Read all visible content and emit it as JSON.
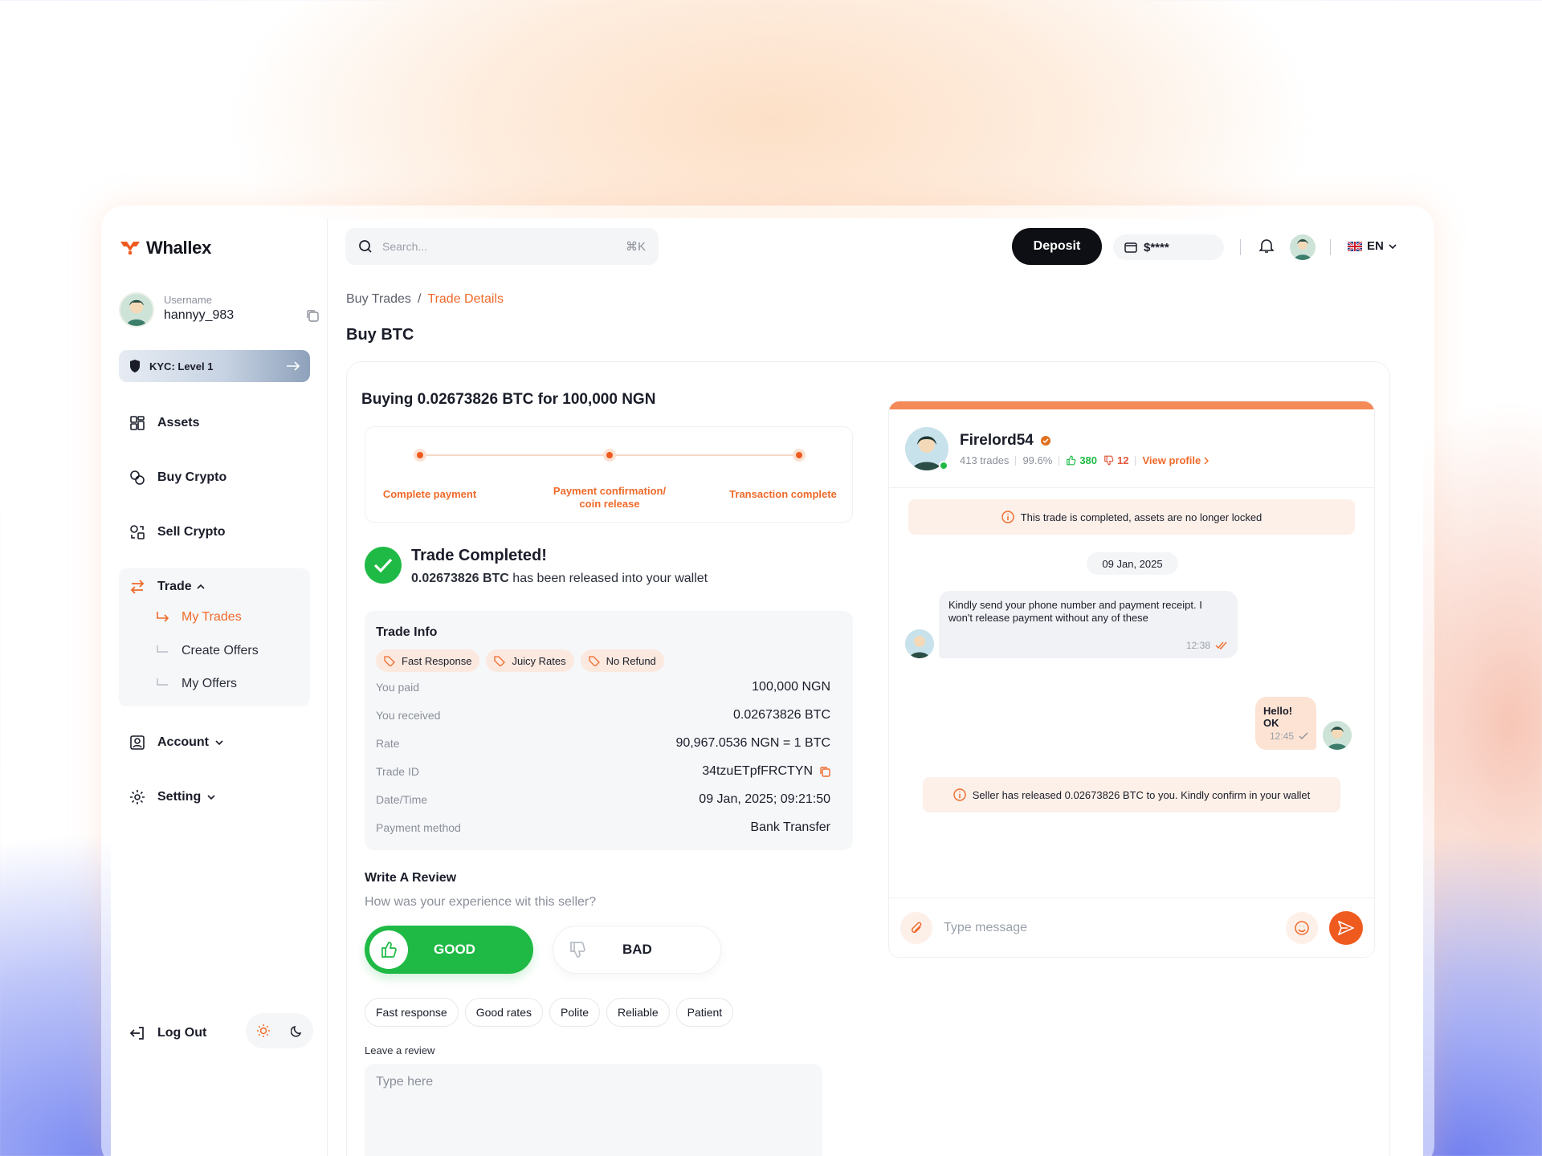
{
  "brand": {
    "name": "Whallex",
    "accent": "#ef6a2a"
  },
  "user": {
    "label": "Username",
    "name": "hannyy_983"
  },
  "kyc": {
    "label": "KYC: Level 1"
  },
  "nav": {
    "assets": "Assets",
    "buy_crypto": "Buy Crypto",
    "sell_crypto": "Sell Crypto",
    "trade": "Trade",
    "trade_sub": [
      "My Trades",
      "Create Offers",
      "My Offers"
    ],
    "account": "Account",
    "setting": "Setting",
    "logout": "Log Out"
  },
  "topbar": {
    "search_placeholder": "Search...",
    "search_shortcut": "⌘K",
    "deposit": "Deposit",
    "balance": "$****",
    "language": "EN"
  },
  "breadcrumb": {
    "parent": "Buy Trades",
    "separator": "/",
    "current": "Trade Details"
  },
  "page_title": "Buy BTC",
  "trade": {
    "title": "Buying 0.02673826 BTC for 100,000 NGN",
    "steps": [
      "Complete payment",
      "Payment confirmation/\ncoin release",
      "Transaction complete"
    ],
    "completed_title": "Trade Completed!",
    "completed_amount": "0.02673826 BTC",
    "completed_text": " has been released into your wallet"
  },
  "info": {
    "title": "Trade Info",
    "tags": [
      "Fast Response",
      "Juicy Rates",
      "No Refund"
    ],
    "rows": [
      {
        "k": "You paid",
        "v": "100,000 NGN"
      },
      {
        "k": "You received",
        "v": "0.02673826 BTC"
      },
      {
        "k": "Rate",
        "v": "90,967.0536 NGN = 1 BTC"
      },
      {
        "k": "Trade ID",
        "v": "34tzuETpfFRCTYN"
      },
      {
        "k": "Date/Time",
        "v": "09 Jan, 2025; 09:21:50"
      },
      {
        "k": "Payment method",
        "v": "Bank Transfer"
      }
    ]
  },
  "review": {
    "title": "Write A Review",
    "question": "How was your experience wit this seller?",
    "good": "GOOD",
    "bad": "BAD",
    "chips": [
      "Fast response",
      "Good rates",
      "Polite",
      "Reliable",
      "Patient"
    ],
    "leave_label": "Leave a review",
    "placeholder": "Type here"
  },
  "chat": {
    "seller": "Firelord54",
    "trades": "413 trades",
    "rating": "99.6%",
    "likes": "380",
    "dislikes": "12",
    "view_profile": "View profile",
    "notice_locked": "This trade is completed, assets are no longer locked",
    "date": "09 Jan, 2025",
    "msg_in": "Kindly send your  phone number and payment receipt. I won't release payment without any of these",
    "msg_in_time": "12:38",
    "msg_out": "Hello! OK",
    "msg_out_time": "12:45",
    "notice_released": "Seller has released  0.02673826 BTC to you. Kindly confirm in your wallet",
    "input_placeholder": "Type message"
  }
}
